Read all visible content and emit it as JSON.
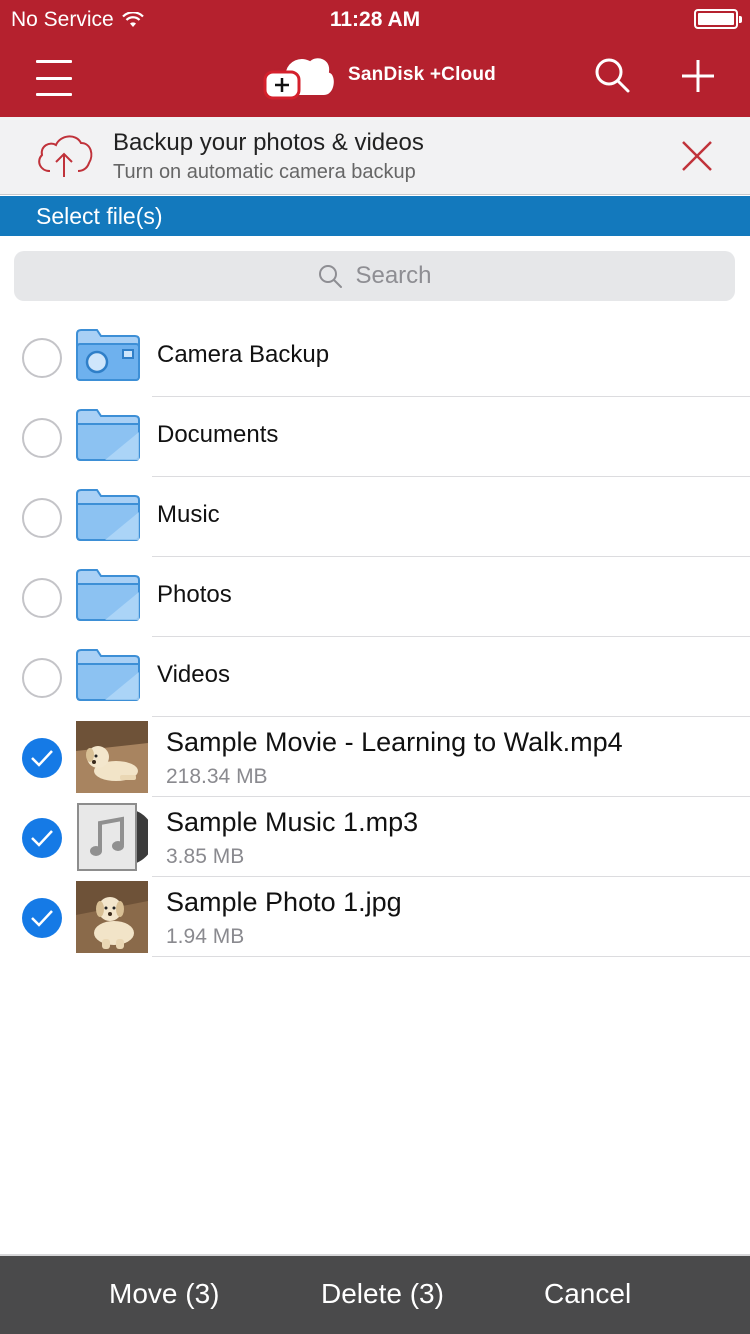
{
  "status_bar": {
    "carrier": "No Service",
    "time": "11:28 AM"
  },
  "nav": {
    "app_name": "SanDisk +Cloud",
    "menu_icon": "hamburger-menu-icon",
    "search_icon": "search-icon",
    "add_icon": "plus-icon",
    "brand_color": "#b5212e"
  },
  "banner": {
    "title": "Backup your photos & videos",
    "subtitle": "Turn on automatic camera backup",
    "icon": "cloud-upload-icon",
    "close_icon": "close-icon"
  },
  "select_bar": {
    "label": "Select file(s)",
    "color": "#1379bd"
  },
  "search": {
    "placeholder": "Search"
  },
  "folders": [
    {
      "name": "Camera Backup",
      "icon": "camera-folder-icon",
      "checked": false
    },
    {
      "name": "Documents",
      "icon": "folder-icon",
      "checked": false
    },
    {
      "name": "Music",
      "icon": "folder-icon",
      "checked": false
    },
    {
      "name": "Photos",
      "icon": "folder-icon",
      "checked": false
    },
    {
      "name": "Videos",
      "icon": "folder-icon",
      "checked": false
    }
  ],
  "files": [
    {
      "name": "Sample Movie - Learning to Walk.mp4",
      "size": "218.34 MB",
      "thumb": "puppy-thumbnail",
      "checked": true
    },
    {
      "name": "Sample Music 1.mp3",
      "size": "3.85 MB",
      "thumb": "music-note-thumbnail",
      "checked": true
    },
    {
      "name": "Sample Photo 1.jpg",
      "size": "1.94 MB",
      "thumb": "puppy-thumbnail",
      "checked": true
    }
  ],
  "toolbar": {
    "move_label": "Move (3)",
    "delete_label": "Delete (3)",
    "cancel_label": "Cancel"
  },
  "colors": {
    "checked": "#157ae6",
    "folder": "#5aa4e3"
  }
}
